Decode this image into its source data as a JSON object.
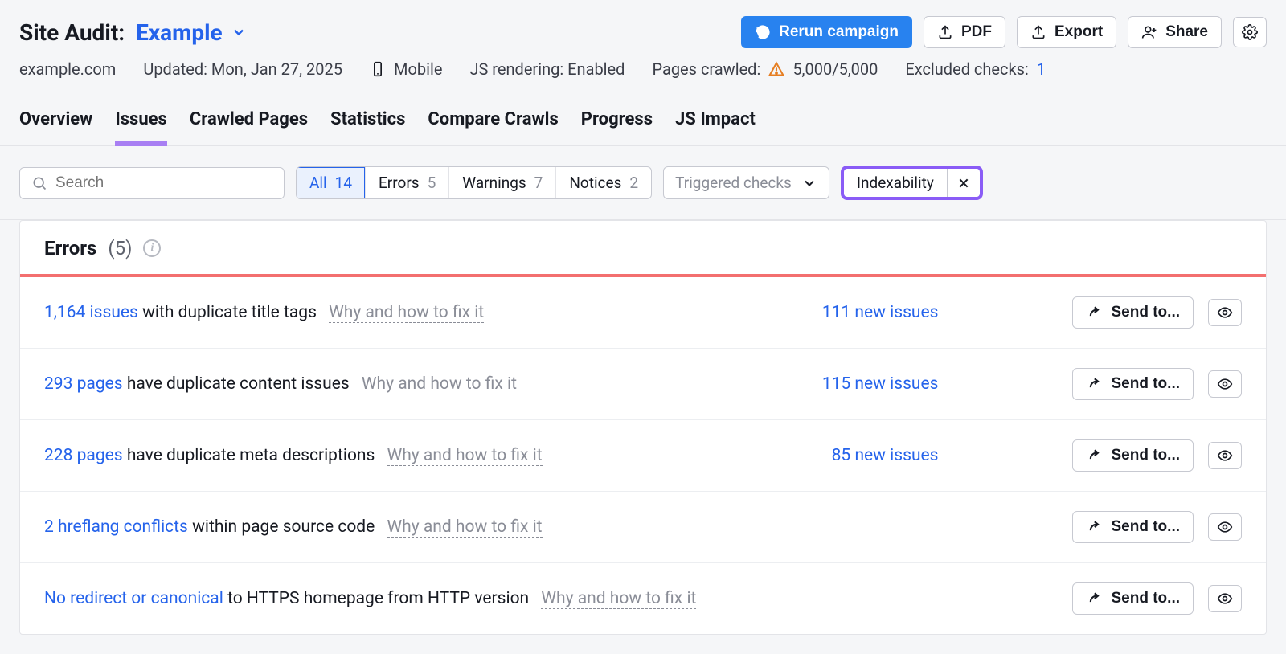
{
  "header": {
    "title": "Site Audit:",
    "campaign": "Example",
    "actions": {
      "rerun": "Rerun campaign",
      "pdf": "PDF",
      "export": "Export",
      "share": "Share"
    }
  },
  "sub": {
    "domain": "example.com",
    "updated": "Updated: Mon, Jan 27, 2025",
    "device": "Mobile",
    "js": "JS rendering: Enabled",
    "crawled_label": "Pages crawled:",
    "crawled_value": "5,000/5,000",
    "excluded_label": "Excluded checks:",
    "excluded_value": "1"
  },
  "tabs": [
    "Overview",
    "Issues",
    "Crawled Pages",
    "Statistics",
    "Compare Crawls",
    "Progress",
    "JS Impact"
  ],
  "activeTab": "Issues",
  "filters": {
    "searchPlaceholder": "Search",
    "seg": [
      {
        "label": "All",
        "count": "14",
        "active": true
      },
      {
        "label": "Errors",
        "count": "5"
      },
      {
        "label": "Warnings",
        "count": "7"
      },
      {
        "label": "Notices",
        "count": "2"
      }
    ],
    "trigger": "Triggered checks",
    "chip": "Indexability"
  },
  "panel": {
    "title": "Errors",
    "count": "(5)",
    "why": "Why and how to fix it",
    "sendto": "Send to...",
    "rows": [
      {
        "head": "1,164 issues",
        "tail": " with duplicate title tags",
        "new": "111 new issues"
      },
      {
        "head": "293 pages",
        "tail": " have duplicate content issues",
        "new": "115 new issues"
      },
      {
        "head": "228 pages",
        "tail": " have duplicate meta descriptions",
        "new": "85 new issues"
      },
      {
        "head": "2 hreflang conflicts",
        "tail": " within page source code",
        "new": ""
      },
      {
        "head": "No redirect or canonical",
        "tail": " to HTTPS homepage from HTTP version",
        "new": ""
      }
    ]
  }
}
